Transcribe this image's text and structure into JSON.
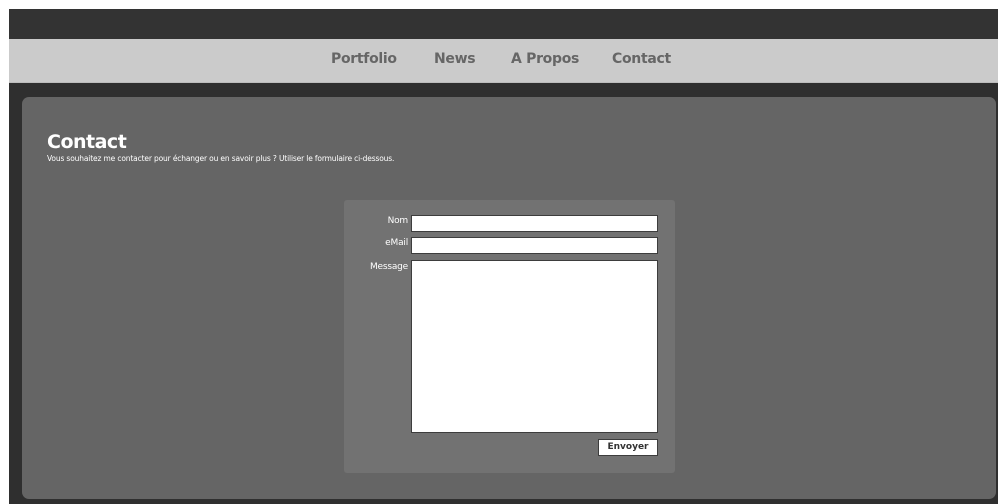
{
  "nav": {
    "items": [
      {
        "label": "Portfolio"
      },
      {
        "label": "News"
      },
      {
        "label": "A Propos"
      },
      {
        "label": "Contact"
      }
    ]
  },
  "page": {
    "title": "Contact",
    "intro": "Vous souhaitez me contacter pour échanger ou en savoir plus ? Utiliser le formulaire ci-dessous."
  },
  "form": {
    "name_label": "Nom",
    "email_label": "eMail",
    "message_label": "Message",
    "name_value": "",
    "email_value": "",
    "message_value": "",
    "submit_label": "Envoyer"
  },
  "colors": {
    "page_background": "#2f2f2f",
    "navbar": "#cbcbcb",
    "nav_text": "#666666",
    "panel": "#656565",
    "form_box": "#727272",
    "text": "#ffffff"
  }
}
